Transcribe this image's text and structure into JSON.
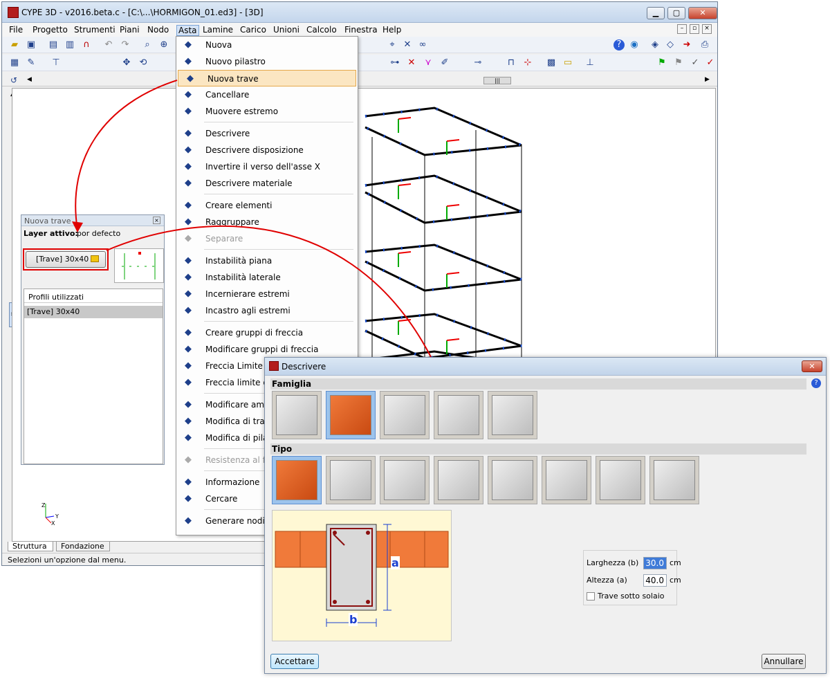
{
  "window": {
    "title": "CYPE 3D - v2016.beta.c - [C:\\...\\HORMIGON_01.ed3] - [3D]",
    "controls": [
      "minimize",
      "restore",
      "close"
    ]
  },
  "menubar": {
    "items": [
      "File",
      "Progetto",
      "Strumenti",
      "Piani",
      "Nodo",
      "Asta",
      "Lamine",
      "Carico",
      "Unioni",
      "Calcolo",
      "Finestra",
      "Help"
    ]
  },
  "asta_menu": {
    "items": [
      {
        "label": "Nuova",
        "icon": "new-bar-icon",
        "enabled": true
      },
      {
        "label": "Nuovo pilastro",
        "icon": "new-column-icon",
        "enabled": true
      },
      {
        "label": "Nuova trave",
        "icon": "new-beam-icon",
        "enabled": true,
        "highlighted": true
      },
      {
        "label": "Cancellare",
        "icon": "delete-icon",
        "enabled": true
      },
      {
        "label": "Muovere estremo",
        "icon": "move-end-icon",
        "enabled": true
      },
      {
        "label": "Descrivere",
        "icon": "describe-icon",
        "enabled": true
      },
      {
        "label": "Descrivere disposizione",
        "icon": "describe-layout-icon",
        "enabled": true
      },
      {
        "label": "Invertire il verso dell'asse X",
        "icon": "invert-axis-icon",
        "enabled": true
      },
      {
        "label": "Descrivere materiale",
        "icon": "material-icon",
        "enabled": true
      },
      {
        "label": "Creare elementi",
        "icon": "create-elements-icon",
        "enabled": true
      },
      {
        "label": "Raggruppare",
        "icon": "group-icon",
        "enabled": true
      },
      {
        "label": "Separare",
        "icon": "separate-icon",
        "enabled": false
      },
      {
        "label": "Instabilità piana",
        "icon": "buckling-plane-icon",
        "enabled": true
      },
      {
        "label": "Instabilità laterale",
        "icon": "buckling-lateral-icon",
        "enabled": true
      },
      {
        "label": "Incernierare estremi",
        "icon": "hinge-icon",
        "enabled": true
      },
      {
        "label": "Incastro agli estremi",
        "icon": "fixed-end-icon",
        "enabled": true
      },
      {
        "label": "Creare gruppi di freccia",
        "icon": "deflection-group-icon",
        "enabled": true
      },
      {
        "label": "Modificare gruppi di freccia",
        "icon": "edit-deflection-icon",
        "enabled": true
      },
      {
        "label": "Freccia Limite",
        "icon": "limit-deflection-icon",
        "enabled": true
      },
      {
        "label": "Freccia limite di",
        "icon": "limit-deflection2-icon",
        "enabled": true
      },
      {
        "label": "Modificare amb",
        "icon": "edit-environment-icon",
        "enabled": true
      },
      {
        "label": "Modifica di trav",
        "icon": "edit-beam-icon",
        "enabled": true
      },
      {
        "label": "Modifica di pilas",
        "icon": "edit-column-icon",
        "enabled": true
      },
      {
        "label": "Resistenza al fuo",
        "icon": "fire-icon",
        "enabled": false
      },
      {
        "label": "Informazione",
        "icon": "info-icon",
        "enabled": true
      },
      {
        "label": "Cercare",
        "icon": "search-icon",
        "enabled": true
      },
      {
        "label": "Generare nodi ir",
        "icon": "generate-nodes-icon",
        "enabled": true
      }
    ]
  },
  "panel": {
    "title": "Nuova trave",
    "layer_label": "Layer attivo:",
    "layer_value": "por defecto",
    "profile_button": "[Trave] 30x40",
    "list_header": "Profili utilizzati",
    "list_items": [
      "[Trave] 30x40"
    ]
  },
  "tabs": [
    "Struttura",
    "Fondazione"
  ],
  "status": "Selezioni un'opzione dal menu.",
  "axes": {
    "z": "Z",
    "y": "Y",
    "x": "X"
  },
  "dialog": {
    "title": "Descrivere",
    "famiglia_label": "Famiglia",
    "tipo_label": "Tipo",
    "famiglia_count": 5,
    "famiglia_selected": 1,
    "tipo_count": 8,
    "tipo_selected": 0,
    "dim_a": "a",
    "dim_b": "b",
    "larghezza_label": "Larghezza (b)",
    "larghezza_value": "30.0",
    "altezza_label": "Altezza (a)",
    "altezza_value": "40.0",
    "unit": "cm",
    "checkbox_label": "Trave sotto solaio",
    "ok": "Accettare",
    "cancel": "Annullare"
  },
  "colors": {
    "accent_red": "#e00000",
    "highlight": "#fbe6c2",
    "selected_thumb": "#9cc3ec",
    "beam_orange": "#f07a3a"
  }
}
